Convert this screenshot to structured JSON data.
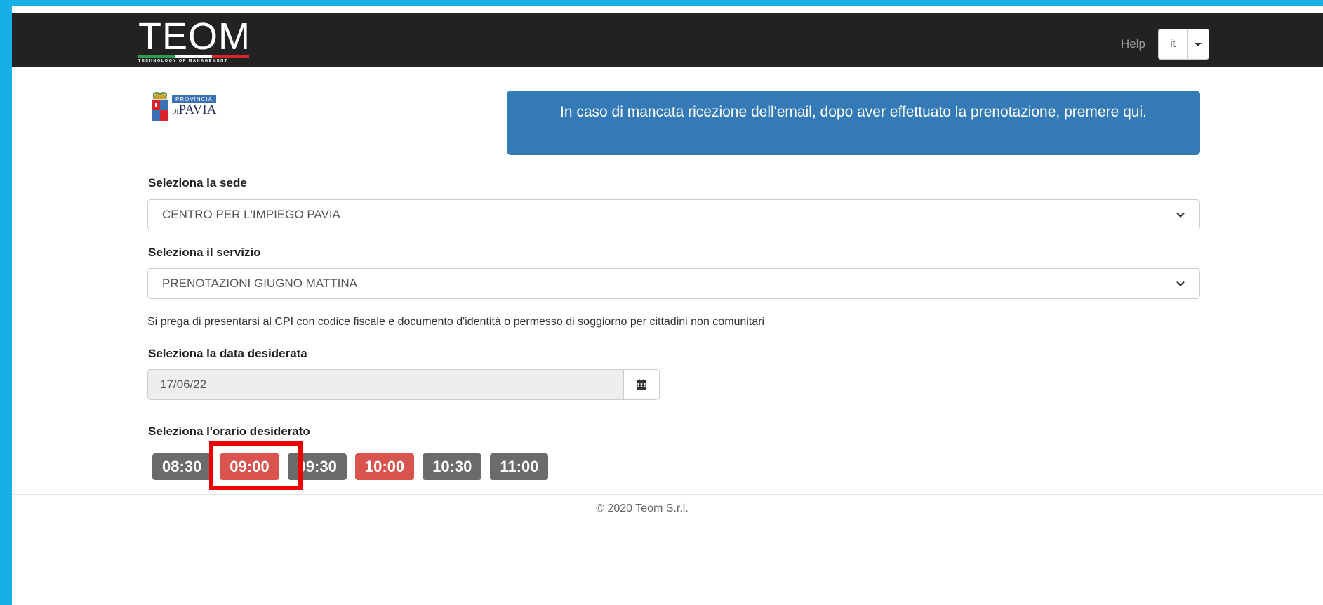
{
  "header": {
    "brand_name": "TEOM",
    "brand_tagline": "TECHNOLOGY OF MANAGEMENT",
    "help_label": "Help",
    "language": "it",
    "colors": {
      "navbar": "#222222",
      "accent_border": "#17b0e6"
    }
  },
  "province_logo": {
    "banner": "PROVINCIA",
    "prefix": "DI",
    "name": "PAVIA"
  },
  "alert": {
    "text": "In caso di mancata ricezione dell'email, dopo aver effettuato la prenotazione, premere qui.",
    "color": "#337ab7"
  },
  "form": {
    "sede_label": "Seleziona la sede",
    "sede_value": "CENTRO PER L'IMPIEGO PAVIA",
    "servizio_label": "Seleziona il servizio",
    "servizio_value": "PRENOTAZIONI GIUGNO MATTINA",
    "note": "Si prega di presentarsi al CPI con codice fiscale e documento d'identità o permesso di soggiorno per cittadini non comunitari",
    "data_label": "Seleziona la data desiderata",
    "data_value": "17/06/22",
    "orario_label": "Seleziona l'orario desiderato"
  },
  "time_slots": [
    {
      "time": "08:30",
      "status": "available",
      "color": "#6b6b6b"
    },
    {
      "time": "09:00",
      "status": "taken",
      "color": "#d9534f",
      "highlighted": true
    },
    {
      "time": "09:30",
      "status": "available",
      "color": "#6b6b6b"
    },
    {
      "time": "10:00",
      "status": "taken",
      "color": "#d9534f"
    },
    {
      "time": "10:30",
      "status": "available",
      "color": "#6b6b6b"
    },
    {
      "time": "11:00",
      "status": "available",
      "color": "#6b6b6b"
    }
  ],
  "footer": {
    "copyright": "© 2020 Teom S.r.l."
  }
}
